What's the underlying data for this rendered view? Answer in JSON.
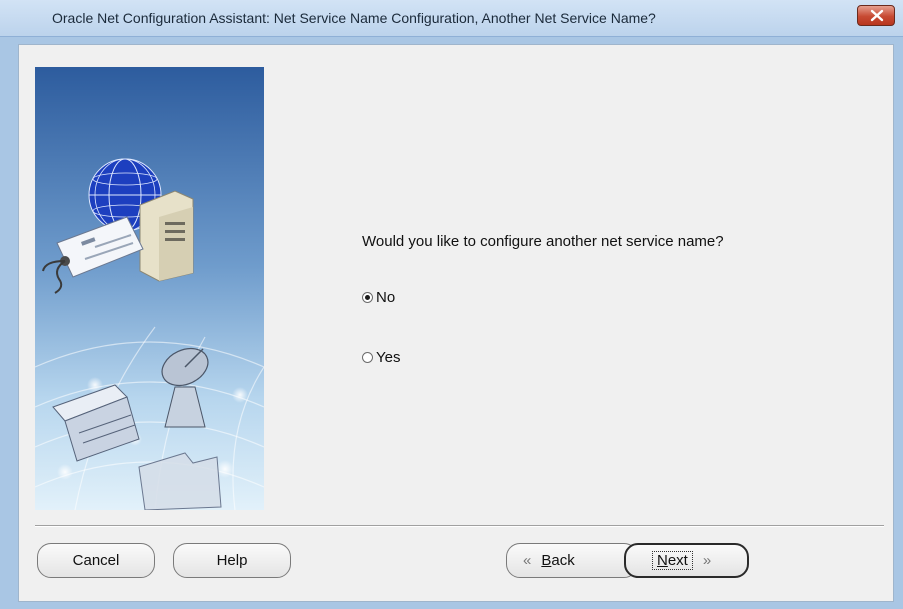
{
  "window": {
    "title": "Oracle Net Configuration Assistant: Net Service Name Configuration, Another Net Service Name?"
  },
  "question": "Would you like to configure another net service name?",
  "options": [
    {
      "label": "No",
      "selected": true
    },
    {
      "label": "Yes",
      "selected": false
    }
  ],
  "buttons": {
    "cancel": "Cancel",
    "help": "Help",
    "back_mnemonic": "B",
    "back_rest": "ack",
    "next_mnemonic": "N",
    "next_rest": "ext"
  },
  "icons": {
    "back": "«",
    "next": "»"
  },
  "colors": {
    "frame": "#a9c6e4",
    "banner_top": "#2f5fa0",
    "banner_bottom": "#d9ecf8",
    "close_button": "#c74a33"
  }
}
